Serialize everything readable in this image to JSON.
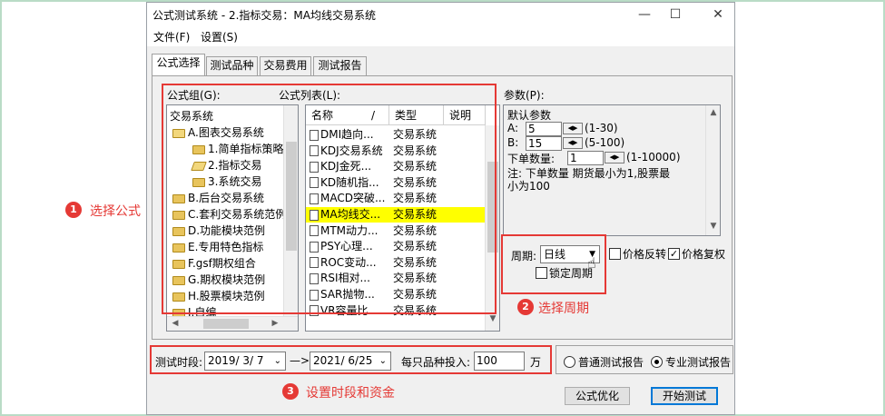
{
  "window": {
    "title": "公式测试系统 - 2.指标交易：MA均线交易系统",
    "minimize": "—",
    "maximize": "☐",
    "close": "✕"
  },
  "menu": [
    "文件(F)",
    "设置(S)"
  ],
  "tabs": [
    "公式选择",
    "测试品种",
    "交易费用",
    "测试报告"
  ],
  "formula_group": {
    "label": "公式组(G):",
    "items": [
      {
        "text": "交易系统"
      },
      {
        "text": "A.图表交易系统"
      },
      {
        "text": "1.简单指标策略"
      },
      {
        "text": "2.指标交易"
      },
      {
        "text": "3.系统交易"
      },
      {
        "text": "B.后台交易系统"
      },
      {
        "text": "C.套利交易系统范例"
      },
      {
        "text": "D.功能模块范例"
      },
      {
        "text": "E.专用特色指标"
      },
      {
        "text": "F.gsf期权组合"
      },
      {
        "text": "G.期权模块范例"
      },
      {
        "text": "H.股票模块范例"
      },
      {
        "text": "I.自编"
      }
    ]
  },
  "formula_list": {
    "label": "公式列表(L):",
    "columns": [
      "名称",
      "/",
      "类型",
      "说明"
    ],
    "rows": [
      {
        "name": "DMI趋向...",
        "type": "交易系统"
      },
      {
        "name": "KDJ交易系统",
        "type": "交易系统"
      },
      {
        "name": "KDJ金死...",
        "type": "交易系统"
      },
      {
        "name": "KD随机指...",
        "type": "交易系统"
      },
      {
        "name": "MACD突破...",
        "type": "交易系统"
      },
      {
        "name": "MA均线交...",
        "type": "交易系统"
      },
      {
        "name": "MTM动力...",
        "type": "交易系统"
      },
      {
        "name": "PSY心理...",
        "type": "交易系统"
      },
      {
        "name": "ROC变动...",
        "type": "交易系统"
      },
      {
        "name": "RSI相对...",
        "type": "交易系统"
      },
      {
        "name": "SAR抛物...",
        "type": "交易系统"
      },
      {
        "name": "VR容量比...",
        "type": "交易系统"
      }
    ],
    "selected_index": 5
  },
  "params": {
    "label": "参数(P):",
    "heading": "默认参数",
    "a_label": "A:",
    "a_value": "5",
    "a_range": "(1-30)",
    "b_label": "B:",
    "b_value": "15",
    "b_range": "(5-100)",
    "qty_label": "下单数量:",
    "qty_value": "1",
    "qty_range": "(1-10000)",
    "note_line1": "注: 下单数量 期货最小为1,股票最",
    "note_line2": "小为100"
  },
  "period": {
    "label": "周期:",
    "value": "日线",
    "lock_label": "锁定周期",
    "price_reverse": "价格反转",
    "price_adjust": "价格复权",
    "price_adjust_checked": true
  },
  "test_period": {
    "label": "测试时段:",
    "start": "2019/ 3/ 7",
    "arrow": "—>",
    "end": "2021/ 6/25",
    "invest_label": "每只品种投入:",
    "invest_value": "100",
    "unit": "万"
  },
  "report": {
    "normal": "普通测试报告",
    "pro": "专业测试报告",
    "selected": "pro"
  },
  "buttons": {
    "optimize": "公式优化",
    "start": "开始测试"
  },
  "annotations": {
    "a1_num": "1",
    "a1_text": "选择公式",
    "a2_num": "2",
    "a2_text": "选择周期",
    "a3_num": "3",
    "a3_text": "设置时段和资金"
  },
  "colors": {
    "highlight": "#ffff00",
    "annotation": "#e53935",
    "default_button_border": "#0078d7"
  }
}
